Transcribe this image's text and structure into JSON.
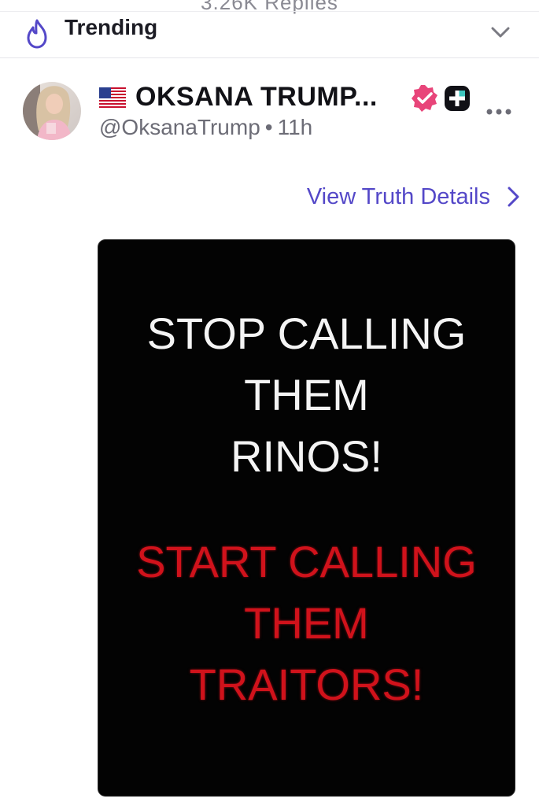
{
  "top_clip": {
    "text": "3.26K Replies"
  },
  "trending": {
    "label": "Trending",
    "icon": "flame-icon",
    "toggle_icon": "chevron-down-icon",
    "accent_color": "#5448c8"
  },
  "post": {
    "author": {
      "flag": "🇺🇸",
      "display_name": "OKSANA TRUMP...",
      "handle": "@OksanaTrump",
      "separator": "•",
      "time": "11h",
      "verified_color": "#e8457a"
    },
    "details_link": "View Truth Details",
    "media": {
      "line1": [
        "STOP CALLING",
        "THEM",
        "RINOS!"
      ],
      "line2": [
        "START CALLING",
        "THEM",
        "TRAITORS!"
      ]
    }
  }
}
